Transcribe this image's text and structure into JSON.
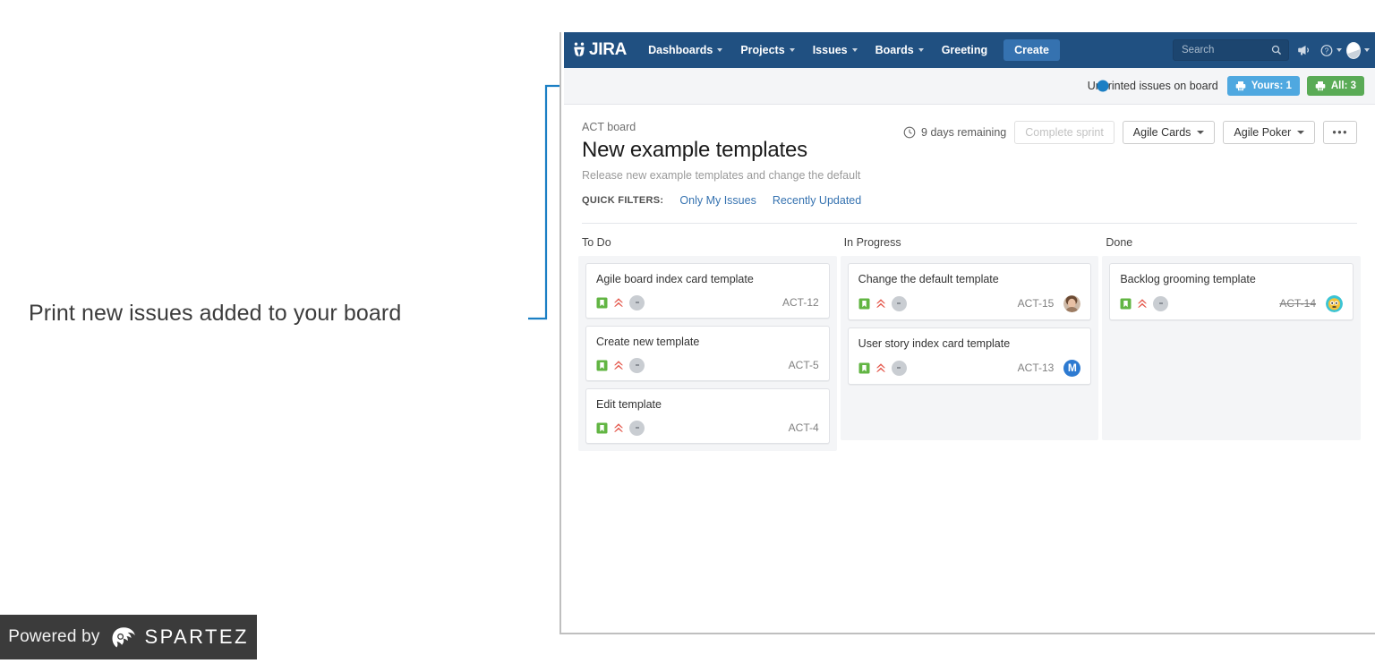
{
  "annotation": {
    "text": "Print new issues added to your board"
  },
  "footer": {
    "powered_by": "Powered by",
    "brand": "SPARTEZ"
  },
  "topnav": {
    "logo_text": "JIRA",
    "items": [
      {
        "label": "Dashboards",
        "has_caret": true
      },
      {
        "label": "Projects",
        "has_caret": true
      },
      {
        "label": "Issues",
        "has_caret": true
      },
      {
        "label": "Boards",
        "has_caret": true
      },
      {
        "label": "Greeting",
        "has_caret": false
      }
    ],
    "create_label": "Create",
    "search_placeholder": "Search",
    "search_value": "",
    "icons": [
      "search-icon",
      "megaphone-icon",
      "help-icon",
      "profile-avatar-icon"
    ]
  },
  "banner": {
    "label": "Unprinted issues on board",
    "yours": "Yours: 1",
    "all": "All: 3",
    "yours_color": "#4fa8e0",
    "all_color": "#5aab56"
  },
  "board": {
    "breadcrumb": "ACT board",
    "title": "New example templates",
    "subtitle": "Release new example templates and change the default",
    "quick_filters_label": "QUICK FILTERS:",
    "quick_filters": [
      "Only My Issues",
      "Recently Updated"
    ],
    "days_remaining": "9 days remaining",
    "complete_sprint": "Complete sprint",
    "agile_cards": "Agile Cards",
    "agile_poker": "Agile Poker",
    "more": "•••"
  },
  "columns": [
    {
      "title": "To Do",
      "cards": [
        {
          "title": "Agile board index card template",
          "key": "ACT-12",
          "done": false,
          "avatar": "none"
        },
        {
          "title": "Create new template",
          "key": "ACT-5",
          "done": false,
          "avatar": "none"
        },
        {
          "title": "Edit template",
          "key": "ACT-4",
          "done": false,
          "avatar": "none"
        }
      ]
    },
    {
      "title": "In Progress",
      "cards": [
        {
          "title": "Change the default template",
          "key": "ACT-15",
          "done": false,
          "avatar": "photo"
        },
        {
          "title": "User story index card template",
          "key": "ACT-13",
          "done": false,
          "avatar": "initial",
          "avatar_initial": "M"
        }
      ]
    },
    {
      "title": "Done",
      "cards": [
        {
          "title": "Backlog grooming template",
          "key": "ACT-14",
          "done": true,
          "avatar": "emoji"
        }
      ]
    }
  ],
  "colors": {
    "nav_bg": "#205081",
    "create_bg": "#3572b0",
    "link": "#3572b0",
    "story_green": "#62b543",
    "priority_red": "#e4584c",
    "leader_blue": "#1b7fc4",
    "column_bg": "#f4f5f7"
  }
}
